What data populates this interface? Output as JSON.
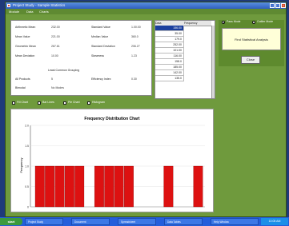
{
  "window": {
    "title": "Project Study - Sample Statistics"
  },
  "menu": [
    "Module",
    "Data",
    "Charts"
  ],
  "stats": [
    {
      "label": "Arithmetic Mean",
      "value": "232.00"
    },
    {
      "label": "Mean Value",
      "value": "221.00"
    },
    {
      "label": "Geometric Mean",
      "value": "267.61"
    },
    {
      "label": "Mean Deviation",
      "value": "10.00"
    },
    {
      "label": "Standard Value",
      "value": "1.00.00"
    },
    {
      "label": "Median Value",
      "value": "360.0"
    },
    {
      "label": "Standard Deviation",
      "value": "206.27"
    },
    {
      "label": "Skewness",
      "value": "1.23"
    },
    {
      "label": "All Products",
      "value": "5"
    },
    {
      "label": "Bimodal",
      "value": "No Modes"
    },
    {
      "label": "Efficiency Index",
      "value": "0.30"
    }
  ],
  "stats_heading": "Least Common Grouping",
  "grid": {
    "headers": [
      "Data",
      "Frequency"
    ],
    "rows": [
      "156.00",
      "35.00",
      "179.0",
      "252.00",
      "101.00",
      "116.00",
      "158.0",
      "185.00",
      "142.00",
      "135.0"
    ],
    "selected_row": 0
  },
  "options": {
    "radio1": "Pass Mode",
    "radio2": "Outlier Mode",
    "notice": "Find Statistical Analysis",
    "button": "Close"
  },
  "chart_options": [
    "Fill Chart",
    "Bar Lines",
    "Pie Chart",
    "Histogram"
  ],
  "chart_data": {
    "type": "bar",
    "title": "Frequency Distribution Chart",
    "ylabel": "Frequency",
    "xlabel": "",
    "ylim": [
      0,
      2.0
    ],
    "yticks": [
      0,
      0.5,
      1.0,
      1.5,
      2.0
    ],
    "ytick_labels": [
      "0",
      "0.5",
      "1.0",
      "1.5",
      "2.0"
    ],
    "values": [
      1,
      1,
      1,
      1,
      1,
      0,
      1,
      1,
      1,
      1,
      0,
      0,
      0,
      1,
      0,
      0,
      1
    ],
    "bar_color": "#dd1111"
  },
  "taskbar": {
    "start": "start",
    "tasks": [
      "Project Study",
      "Document",
      "Spreadsheet",
      "Data Tables",
      "Help Window"
    ],
    "clock": "10:05 AM"
  }
}
